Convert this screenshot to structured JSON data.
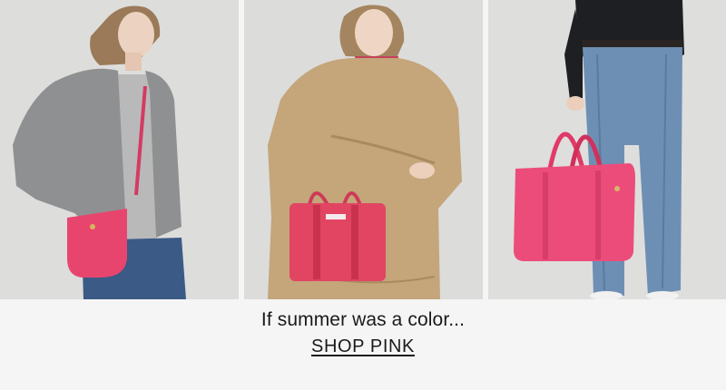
{
  "promo": {
    "headline": "If summer was a color...",
    "cta_label": "SHOP PINK",
    "accent_color": "#e8456e",
    "photos": [
      {
        "name": "model-crossbody-bag-photo"
      },
      {
        "name": "model-tote-bag-photo"
      },
      {
        "name": "model-duffel-bag-photo"
      }
    ]
  }
}
